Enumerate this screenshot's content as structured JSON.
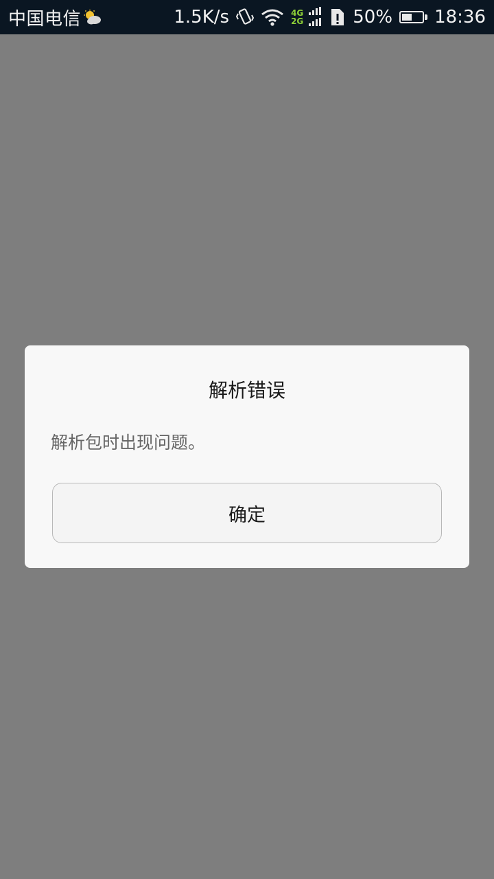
{
  "status_bar": {
    "carrier": "中国电信",
    "weather_icon": "partly-cloudy-icon",
    "net_speed": "1.5K/s",
    "vibrate_icon": "vibrate-icon",
    "wifi_icon": "wifi-icon",
    "network_top": "4G",
    "network_bottom": "2G",
    "signal_icon": "signal-icon",
    "sim_icon": "sim-alert-icon",
    "battery_percent": "50%",
    "battery_level": 0.5,
    "time": "18:36",
    "bg_color": "#0a1622",
    "network_color": "#8ed037"
  },
  "dialog": {
    "title": "解析错误",
    "message": "解析包时出现问题。",
    "confirm_label": "确定"
  }
}
